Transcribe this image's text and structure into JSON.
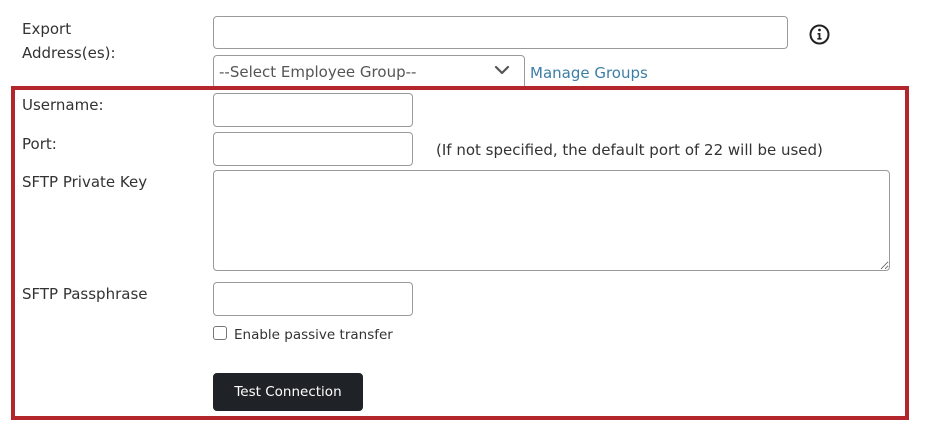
{
  "export": {
    "label_line1": "Export",
    "label_line2": "Address(es):",
    "value": "",
    "group_select_value": "--Select Employee Group--",
    "manage_groups_link": "Manage Groups"
  },
  "sftp": {
    "username_label": "Username:",
    "username_value": "",
    "port_label": "Port:",
    "port_value": "",
    "port_note": "(If not specified, the default port of 22 will be used)",
    "private_key_label": "SFTP Private Key",
    "private_key_value": "",
    "passphrase_label": "SFTP Passphrase",
    "passphrase_value": "",
    "passive_transfer_label": "Enable passive transfer",
    "passive_transfer_checked": false,
    "test_button_label": "Test Connection"
  },
  "colors": {
    "highlight_border": "#b3262b",
    "link": "#3d7ea6",
    "button_bg": "#1f2328"
  },
  "icons": {
    "info": "info-icon",
    "select_arrow": "chevron-down-icon"
  }
}
